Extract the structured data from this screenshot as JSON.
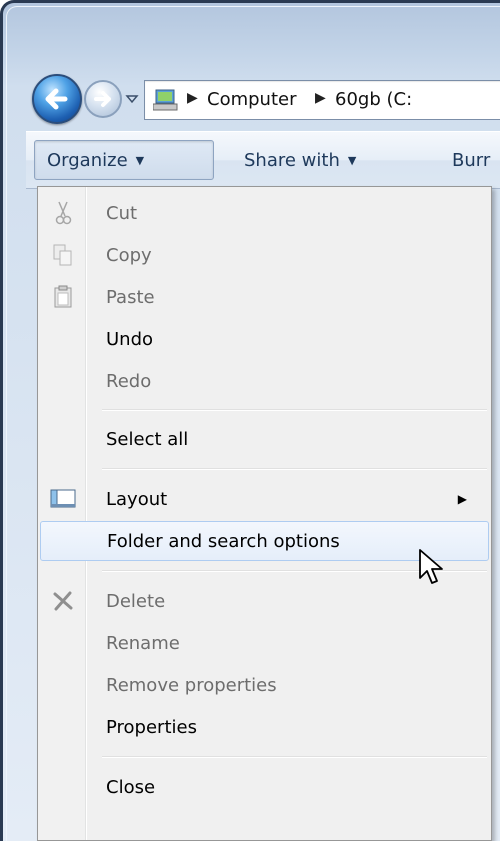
{
  "breadcrumb": {
    "items": [
      "Computer",
      "60gb (C:"
    ]
  },
  "command_bar": {
    "organize_label": "Organize",
    "share_label": "Share with",
    "burn_label": "Burr"
  },
  "menu": {
    "items": [
      {
        "label": "Cut",
        "enabled": false,
        "icon": "scissors-icon"
      },
      {
        "label": "Copy",
        "enabled": false,
        "icon": "copy-icon"
      },
      {
        "label": "Paste",
        "enabled": false,
        "icon": "clipboard-icon"
      },
      {
        "label": "Undo",
        "enabled": true
      },
      {
        "label": "Redo",
        "enabled": false
      },
      {
        "label": "Select all",
        "enabled": true
      },
      {
        "label": "Layout",
        "enabled": true,
        "icon": "layout-icon",
        "submenu": true
      },
      {
        "label": "Folder and search options",
        "enabled": true,
        "hover": true
      },
      {
        "label": "Delete",
        "enabled": false,
        "icon": "delete-x-icon"
      },
      {
        "label": "Rename",
        "enabled": false
      },
      {
        "label": "Remove properties",
        "enabled": false
      },
      {
        "label": "Properties",
        "enabled": true
      },
      {
        "label": "Close",
        "enabled": true
      }
    ]
  },
  "colors": {
    "hover_border": "#aeccf1",
    "disabled_text": "#6d6d6d",
    "command_text": "#1e395b"
  }
}
